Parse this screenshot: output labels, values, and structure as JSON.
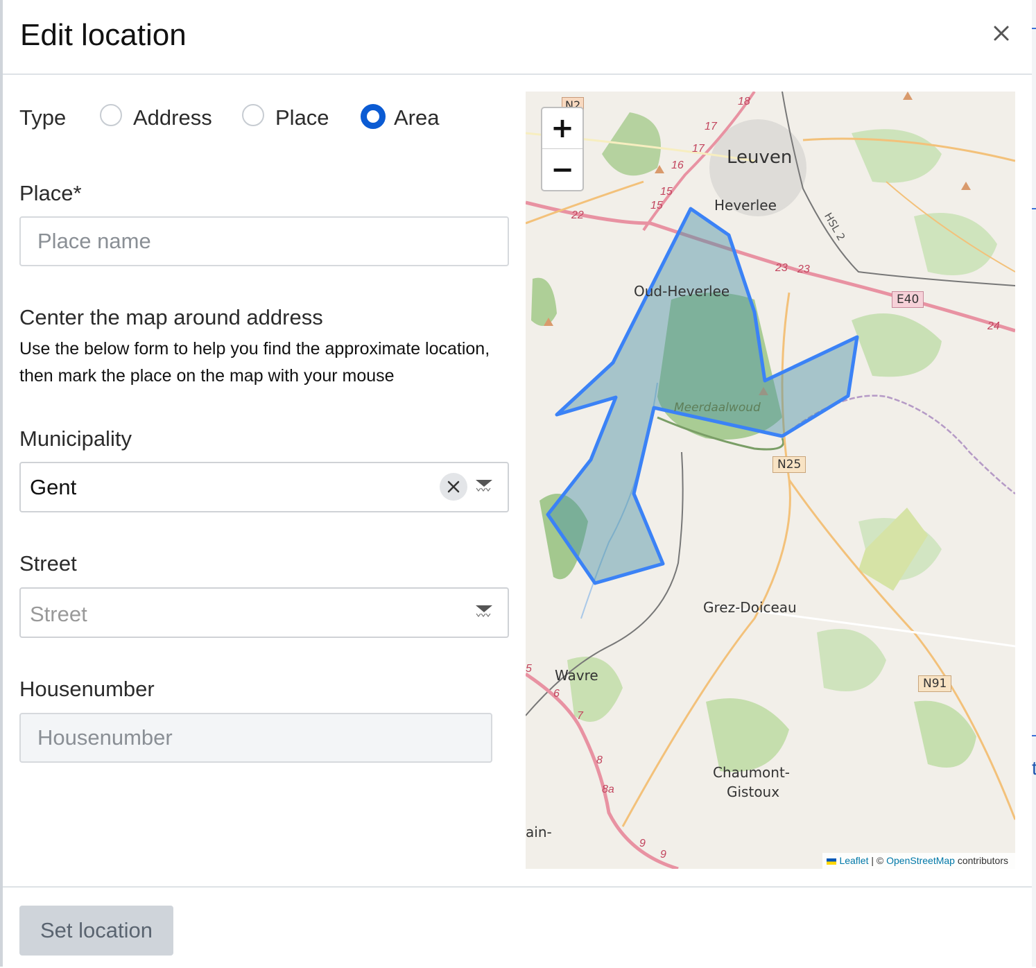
{
  "modal": {
    "title": "Edit location",
    "close_icon": "close-icon"
  },
  "type": {
    "label": "Type",
    "options": [
      {
        "label": "Address",
        "checked": false
      },
      {
        "label": "Place",
        "checked": false
      },
      {
        "label": "Area",
        "checked": true
      }
    ]
  },
  "place": {
    "label": "Place*",
    "placeholder": "Place name",
    "value": ""
  },
  "center": {
    "title": "Center the map around address",
    "line1": "Use the below form to help you find the approximate location,",
    "line2": "then mark the place on the map with your mouse"
  },
  "municipality": {
    "label": "Municipality",
    "value": "Gent"
  },
  "street": {
    "label": "Street",
    "placeholder": "Street"
  },
  "housenumber": {
    "label": "Housenumber",
    "placeholder": "Housenumber"
  },
  "map": {
    "zoom_in": "+",
    "zoom_out": "−",
    "places": {
      "leuven": "Leuven",
      "heverlee": "Heverlee",
      "oud_heverlee": "Oud-Heverlee",
      "meerdaalwoud": "Meerdaalwoud",
      "grez_doiceau": "Grez-Doiceau",
      "wavre": "Wavre",
      "chaumont_1": "Chaumont-",
      "chaumont_2": "Gistoux",
      "ain": "ain-"
    },
    "roads": {
      "n2": "N2",
      "e40": "E40",
      "n25": "N25",
      "n91": "N91",
      "hsl2": "HSL 2",
      "r18": "18",
      "r17a": "17",
      "r17b": "17",
      "r16": "16",
      "r15a": "15",
      "r15b": "15",
      "r22": "22",
      "r23a": "23",
      "r23b": "23",
      "r24": "24",
      "r6": "6",
      "r7": "7",
      "r8": "8",
      "r8a": "8a",
      "r9a": "9",
      "r9b": "9",
      "r5": "5"
    },
    "attribution": {
      "leaflet": "Leaflet",
      "sep": " | © ",
      "osm": "OpenStreetMap",
      "contributors": " contributors"
    },
    "polygon_color": "#3b82f6",
    "polygon_fill": "#4a90a4"
  },
  "footer": {
    "set_location": "Set location"
  }
}
